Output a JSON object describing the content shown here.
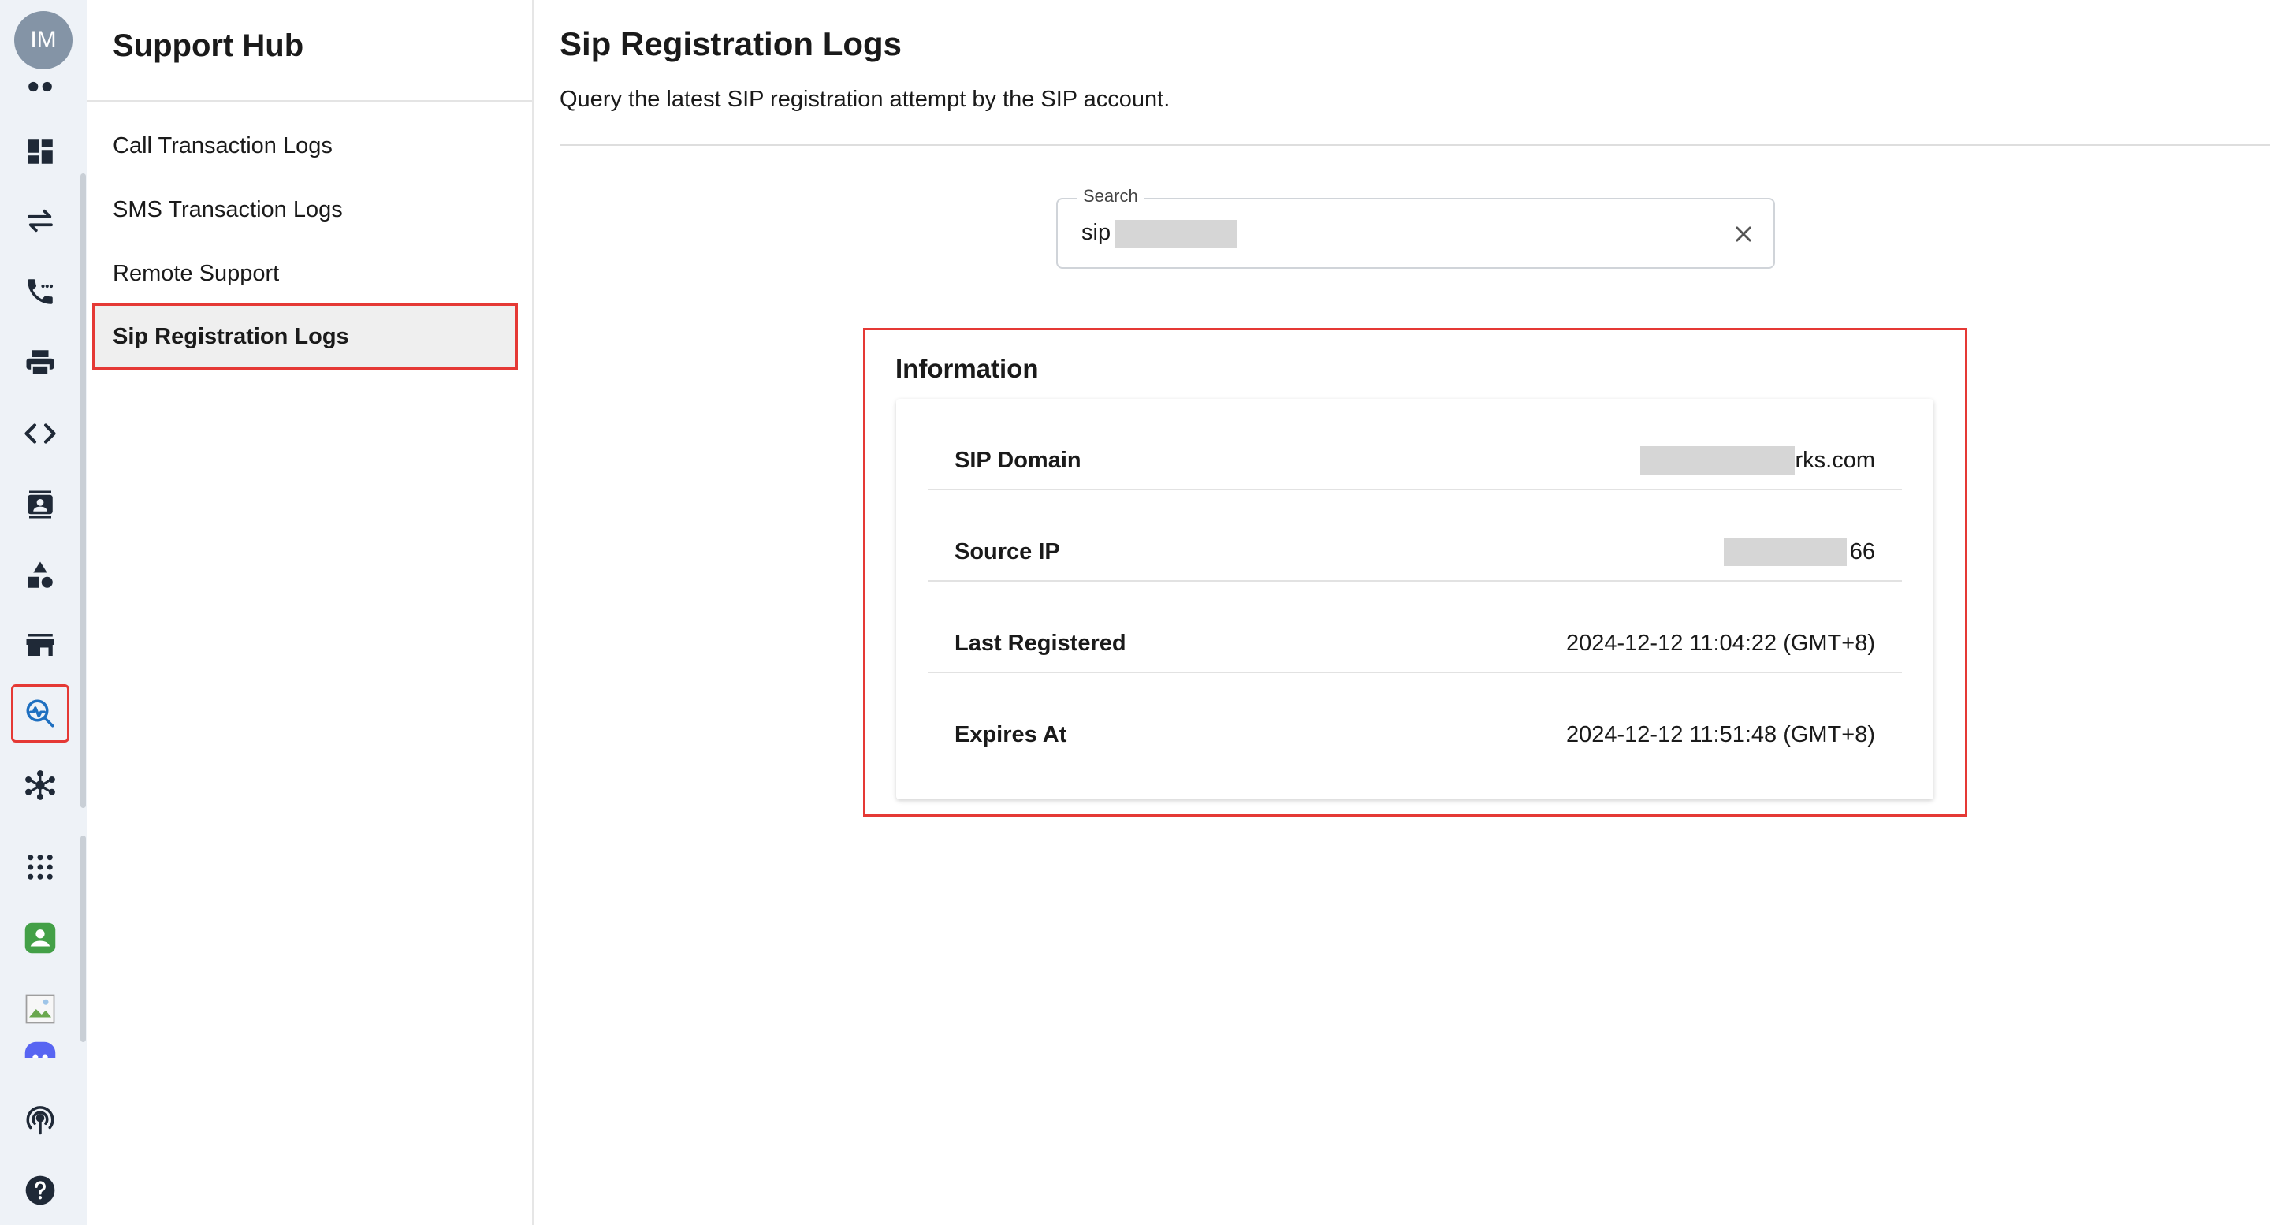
{
  "rail": {
    "avatar_initials": "IM",
    "icons": [
      "dots-icon",
      "dashboard-icon",
      "transfer-arrows-icon",
      "phone-icon",
      "printer-icon",
      "code-icon",
      "contact-card-icon",
      "shapes-icon",
      "storefront-icon",
      "monitor-search-icon",
      "network-hub-icon",
      "apps-grid-icon",
      "chat-app-icon",
      "broken-image-icon",
      "discord-icon",
      "broadcast-icon",
      "help-icon"
    ]
  },
  "subnav": {
    "title": "Support Hub",
    "items": [
      {
        "label": "Call Transaction Logs"
      },
      {
        "label": "SMS Transaction Logs"
      },
      {
        "label": "Remote Support"
      },
      {
        "label": "Sip Registration Logs"
      }
    ],
    "active_index": 3
  },
  "main": {
    "title": "Sip Registration Logs",
    "description": "Query the latest SIP registration attempt by the SIP account.",
    "search": {
      "label": "Search",
      "value": "sip"
    },
    "info": {
      "title": "Information",
      "rows": [
        {
          "key": "SIP Domain",
          "value": "rks.com"
        },
        {
          "key": "Source IP",
          "value": "118.          66"
        },
        {
          "key": "Last Registered",
          "value": "2024-12-12 11:04:22 (GMT+8)"
        },
        {
          "key": "Expires At",
          "value": "2024-12-12 11:51:48 (GMT+8)"
        }
      ]
    }
  },
  "colors": {
    "rail_bg": "#eef2f7",
    "highlight": "#e53935",
    "avatar_bg": "#8494a6",
    "app_green": "#43a047",
    "discord_blue": "#5865f2"
  }
}
